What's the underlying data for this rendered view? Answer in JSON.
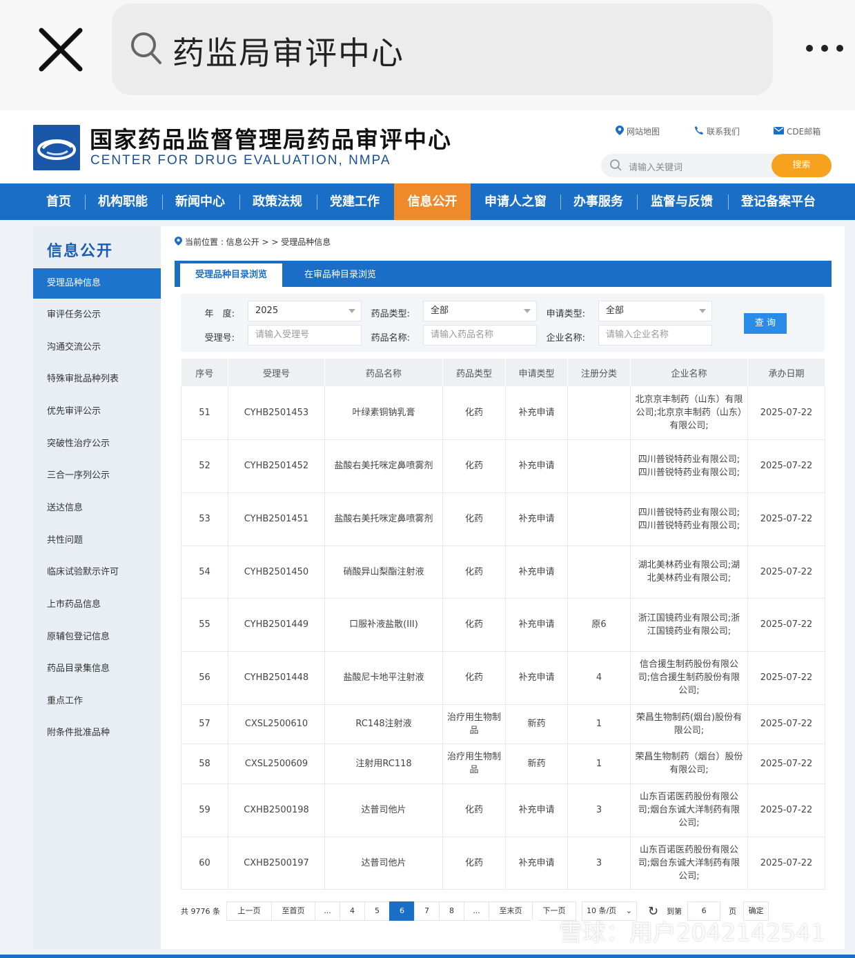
{
  "search": {
    "query": "药监局审评中心"
  },
  "header": {
    "title_cn": "国家药品监督管理局药品审评中心",
    "title_en": "CENTER FOR DRUG EVALUATION, NMPA",
    "links": [
      "网站地图",
      "联系我们",
      "CDE邮箱"
    ],
    "search_placeholder": "请输入关键词",
    "search_button": "搜索"
  },
  "nav": [
    "首页",
    "机构职能",
    "新闻中心",
    "政策法规",
    "党建工作",
    "信息公开",
    "申请人之窗",
    "办事服务",
    "监督与反馈",
    "登记备案平台"
  ],
  "nav_active": "信息公开",
  "sidebar": {
    "title": "信息公开",
    "items": [
      "受理品种信息",
      "审评任务公示",
      "沟通交流公示",
      "特殊审批品种列表",
      "优先审评公示",
      "突破性治疗公示",
      "三合一序列公示",
      "送达信息",
      "共性问题",
      "临床试验默示许可",
      "上市药品信息",
      "原辅包登记信息",
      "药品目录集信息",
      "重点工作",
      "附条件批准品种"
    ]
  },
  "breadcrumb": "当前位置 : 信息公开 > > 受理品种信息",
  "tabs": [
    "受理品种目录浏览",
    "在审品种目录浏览"
  ],
  "filters": {
    "year_label": "年　度:",
    "year_value": "2025",
    "drug_type_label": "药品类型:",
    "drug_type_value": "全部",
    "apply_type_label": "申请类型:",
    "apply_type_value": "全部",
    "accept_no_label": "受理号:",
    "accept_no_placeholder": "请输入受理号",
    "drug_name_label": "药品名称:",
    "drug_name_placeholder": "请输入药品名称",
    "company_label": "企业名称:",
    "company_placeholder": "请输入企业名称",
    "query_button": "查 询"
  },
  "table": {
    "headers": [
      "序号",
      "受理号",
      "药品名称",
      "药品类型",
      "申请类型",
      "注册分类",
      "企业名称",
      "承办日期"
    ],
    "rows": [
      [
        "51",
        "CYHB2501453",
        "叶绿素铜钠乳膏",
        "化药",
        "补充申请",
        "",
        "北京京丰制药（山东）有限公司;北京京丰制药（山东）有限公司;",
        "2025-07-22"
      ],
      [
        "52",
        "CYHB2501452",
        "盐酸右美托咪定鼻喷雾剂",
        "化药",
        "补充申请",
        "",
        "四川普锐特药业有限公司;四川普锐特药业有限公司;",
        "2025-07-22"
      ],
      [
        "53",
        "CYHB2501451",
        "盐酸右美托咪定鼻喷雾剂",
        "化药",
        "补充申请",
        "",
        "四川普锐特药业有限公司;四川普锐特药业有限公司;",
        "2025-07-22"
      ],
      [
        "54",
        "CYHB2501450",
        "硝酸异山梨酯注射液",
        "化药",
        "补充申请",
        "",
        "湖北美林药业有限公司;湖北美林药业有限公司;",
        "2025-07-22"
      ],
      [
        "55",
        "CYHB2501449",
        "口服补液盐散(III)",
        "化药",
        "补充申请",
        "原6",
        "浙江国镜药业有限公司;浙江国镜药业有限公司;",
        "2025-07-22"
      ],
      [
        "56",
        "CYHB2501448",
        "盐酸尼卡地平注射液",
        "化药",
        "补充申请",
        "4",
        "信合援生制药股份有限公司;信合援生制药股份有限公司;",
        "2025-07-22"
      ],
      [
        "57",
        "CXSL2500610",
        "RC148注射液",
        "治疗用生物制品",
        "新药",
        "1",
        "荣昌生物制药(烟台)股份有限公司;",
        "2025-07-22"
      ],
      [
        "58",
        "CXSL2500609",
        "注射用RC118",
        "治疗用生物制品",
        "新药",
        "1",
        "荣昌生物制药（烟台）股份有限公司;",
        "2025-07-22"
      ],
      [
        "59",
        "CXHB2500198",
        "达普司他片",
        "化药",
        "补充申请",
        "3",
        "山东百诺医药股份有限公司;烟台东诚大洋制药有限公司;",
        "2025-07-22"
      ],
      [
        "60",
        "CXHB2500197",
        "达普司他片",
        "化药",
        "补充申请",
        "3",
        "山东百诺医药股份有限公司;烟台东诚大洋制药有限公司;",
        "2025-07-22"
      ]
    ]
  },
  "pagination": {
    "total": "共 9776 条",
    "prev": "上一页",
    "first": "至首页",
    "ellipsis": "...",
    "pages": [
      "4",
      "5",
      "6",
      "7",
      "8"
    ],
    "current": "6",
    "last": "至末页",
    "next": "下一页",
    "page_size": "10 条/页",
    "goto_label": "到第",
    "goto_value": "6",
    "page_unit": "页",
    "confirm": "确定"
  },
  "watermark": "雪球：用户2042142541",
  "colors": {
    "brand_blue": "#1b6ec6",
    "active_orange": "#ef8a2a",
    "search_orange": "#f6a21e"
  }
}
